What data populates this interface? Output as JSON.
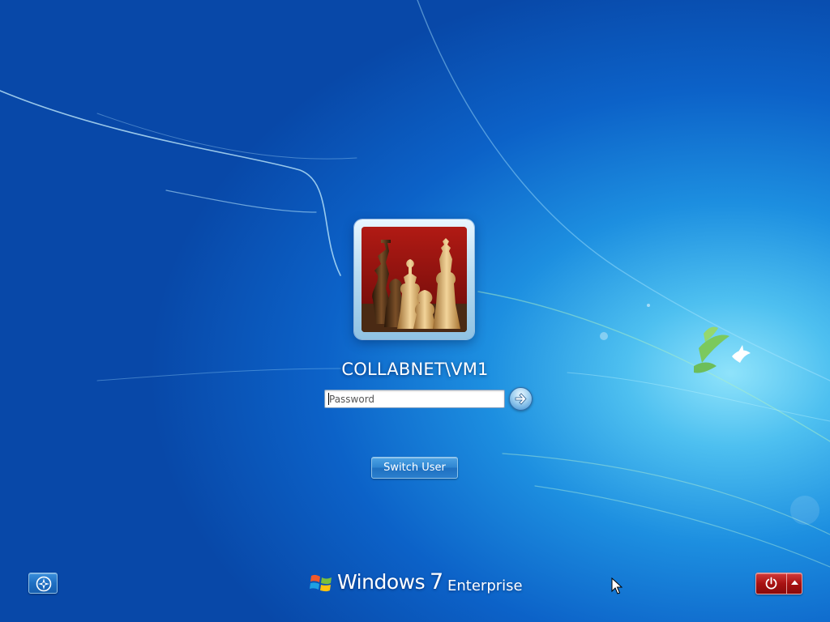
{
  "user": {
    "name": "COLLABNET\\VM1",
    "avatar_icon": "chess-pieces-picture"
  },
  "password": {
    "placeholder": "Password",
    "value": ""
  },
  "buttons": {
    "submit_icon": "arrow-right-icon",
    "switch_user_label": "Switch User",
    "ease_of_access_icon": "ease-of-access-icon",
    "shutdown_icon": "power-icon",
    "shutdown_options_icon": "triangle-up-icon"
  },
  "branding": {
    "windows": "Windows",
    "version": "7",
    "edition": "Enterprise"
  },
  "colors": {
    "background": "#1475d4",
    "power_button": "#a81212",
    "switch_user_button": "#2f86d2"
  }
}
